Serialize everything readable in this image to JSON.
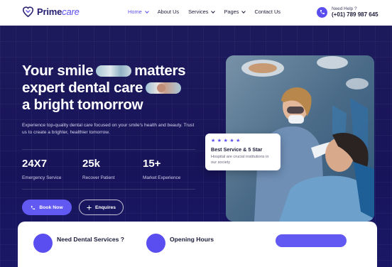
{
  "brand": {
    "name_part1": "Prime",
    "name_part2": "care",
    "logo_icon": "tooth-heart-icon"
  },
  "nav": {
    "items": [
      {
        "label": "Home",
        "dropdown": true,
        "active": true
      },
      {
        "label": "About Us",
        "dropdown": false,
        "active": false
      },
      {
        "label": "Services",
        "dropdown": true,
        "active": false
      },
      {
        "label": "Pages",
        "dropdown": true,
        "active": false
      },
      {
        "label": "Contact Us",
        "dropdown": false,
        "active": false
      }
    ]
  },
  "help": {
    "label": "Need Help ?",
    "phone": "(+01) 789 987 645",
    "icon": "phone-icon"
  },
  "hero": {
    "headline_line1_a": "Your smile",
    "headline_line1_b": "matters",
    "headline_line2": "expert dental care",
    "headline_line3": "a bright tomorrow",
    "description": "Experience top-quality dental care focused on your smile's health and beauty. Trust us to create a brighter, healthier tomorrow.",
    "stats": [
      {
        "value": "24X7",
        "label": "Emergency Service"
      },
      {
        "value": "25k",
        "label": "Recover Patient"
      },
      {
        "value": "15+",
        "label": "Market Experience"
      }
    ],
    "book_label": "Book Now",
    "enquiry_label": "Enquires"
  },
  "review_card": {
    "stars": 5,
    "title": "Best Service & 5 Star",
    "text": "Hospital are crucial institutions in our society"
  },
  "bottom_card": {
    "item1_title": "Need Dental Services ?",
    "item2_title": "Opening Hours"
  },
  "colors": {
    "accent": "#5b4ef0",
    "hero_bg": "#1d1a5c",
    "brand_dark": "#241c6e"
  }
}
